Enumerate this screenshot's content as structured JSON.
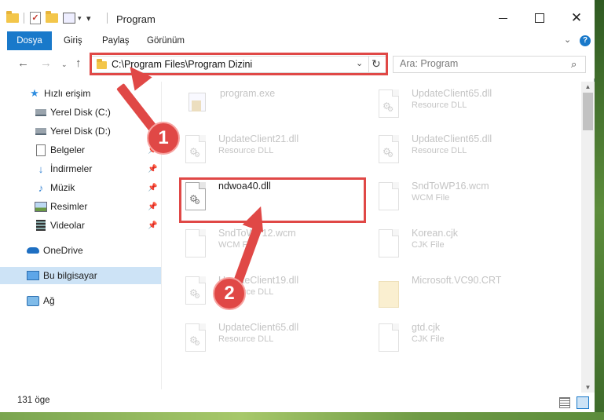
{
  "window": {
    "title": "Program"
  },
  "ribbon": {
    "tabs": [
      {
        "label": "Dosya",
        "active": true
      },
      {
        "label": "Giriş",
        "active": false
      },
      {
        "label": "Paylaş",
        "active": false
      },
      {
        "label": "Görünüm",
        "active": false
      }
    ],
    "accent": "#1979ca"
  },
  "address": {
    "path": "C:\\Program Files\\Program Dizini"
  },
  "search": {
    "placeholder": "Ara: Program"
  },
  "sidebar": {
    "items": [
      {
        "label": "Hızlı erişim",
        "icon": "star-icon",
        "pinned": false
      },
      {
        "label": "Yerel Disk (C:)",
        "icon": "drive-icon",
        "pinned": false
      },
      {
        "label": "Yerel Disk (D:)",
        "icon": "drive-icon",
        "pinned": false
      },
      {
        "label": "Belgeler",
        "icon": "documents-icon",
        "pinned": true
      },
      {
        "label": "İndirmeler",
        "icon": "download-icon",
        "pinned": true
      },
      {
        "label": "Müzik",
        "icon": "music-icon",
        "pinned": true
      },
      {
        "label": "Resimler",
        "icon": "pictures-icon",
        "pinned": true
      },
      {
        "label": "Videolar",
        "icon": "video-icon",
        "pinned": true
      },
      {
        "label": "OneDrive",
        "icon": "cloud-icon",
        "pinned": false
      },
      {
        "label": "Bu bilgisayar",
        "icon": "computer-icon",
        "pinned": false,
        "selected": true
      },
      {
        "label": "Ağ",
        "icon": "network-icon",
        "pinned": false
      }
    ]
  },
  "files": [
    {
      "name": "program.exe",
      "type": "",
      "icon": "exe-icon",
      "faded": true
    },
    {
      "name": "UpdateClient65.dll",
      "type": "Resource DLL",
      "icon": "dll-icon",
      "faded": true
    },
    {
      "name": "UpdateClient21.dll",
      "type": "Resource DLL",
      "icon": "dll-icon",
      "faded": true
    },
    {
      "name": "UpdateClient65.dll",
      "type": "Resource DLL",
      "icon": "dll-icon",
      "faded": true
    },
    {
      "name": "ndwoa40.dll",
      "type": "",
      "icon": "dll-icon",
      "faded": false
    },
    {
      "name": "SndToWP16.wcm",
      "type": "WCM File",
      "icon": "file-icon",
      "faded": true
    },
    {
      "name": "SndToWP12.wcm",
      "type": "WCM File",
      "icon": "file-icon",
      "faded": true
    },
    {
      "name": "Korean.cjk",
      "type": "CJK File",
      "icon": "file-icon",
      "faded": true
    },
    {
      "name": "UpdateClient19.dll",
      "type": "Resource DLL",
      "icon": "dll-icon",
      "faded": true
    },
    {
      "name": "Microsoft.VC90.CRT",
      "type": "",
      "icon": "folder-icon",
      "faded": true
    },
    {
      "name": "UpdateClient65.dll",
      "type": "Resource DLL",
      "icon": "dll-icon",
      "faded": true
    },
    {
      "name": "gtd.cjk",
      "type": "CJK File",
      "icon": "file-icon",
      "faded": true
    }
  ],
  "status": {
    "item_count": "131 öge"
  },
  "annotations": {
    "step1": "1",
    "step2": "2",
    "color": "#e04846"
  }
}
